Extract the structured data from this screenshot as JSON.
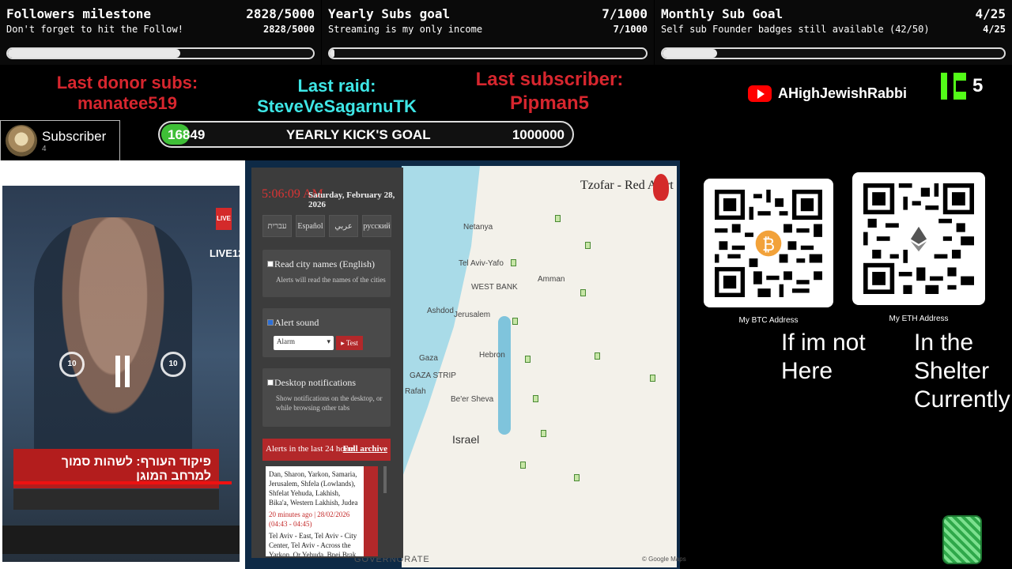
{
  "goals": [
    {
      "title": "Followers milestone",
      "count": "2828/5000",
      "subtitle": "Don't forget to hit the Follow!",
      "count2": "2828/5000",
      "progress": 0.5656
    },
    {
      "title": "Yearly Subs goal",
      "count": "7/1000",
      "subtitle": "Streaming is my only income",
      "count2": "7/1000",
      "progress": 0.007
    },
    {
      "title": "Monthly Sub Goal",
      "count": "4/25",
      "subtitle": "Self sub Founder badges still available (42/50)",
      "count2": "4/25",
      "progress": 0.16
    }
  ],
  "events": {
    "donor_label": "Last donor subs:",
    "donor_name": "manatee519",
    "raid_label": "Last raid:",
    "raid_name": "SteveVeSagarnuTK",
    "sub_label": "Last subscriber:",
    "sub_name": "Pipman5"
  },
  "youtube": {
    "channel": "AHighJewishRabbi"
  },
  "kick": {
    "count": "5"
  },
  "subscriber_card": {
    "title": "Subscriber",
    "count": "4"
  },
  "kick_goal": {
    "current": "16849",
    "label": "YEARLY KICK'S GOAL",
    "target": "1000000",
    "progress": 0.0168
  },
  "video": {
    "live_badge": "LIVE",
    "channel_logo": "LIVE12",
    "headline": "פיקוד העורף: לשהות סמוך למרחב המוגן",
    "skip_back": "10",
    "skip_forward": "10"
  },
  "tzofar": {
    "time": "5:06:09 AM",
    "date": "Saturday, February 28, 2026",
    "languages": [
      "עברית",
      "Español",
      "عربي",
      "русский"
    ],
    "read_city": {
      "title": "Read city names (English)",
      "desc": "Alerts will read the names of the cities",
      "checked": false
    },
    "alert_sound": {
      "title": "Alert sound",
      "select": "Alarm",
      "test": "Test",
      "checked": true
    },
    "desktop_notif": {
      "title": "Desktop notifications",
      "desc": "Show notifications on the desktop, or while browsing other tabs",
      "checked": false
    },
    "alerts_header": "Alerts in the last 24 hours",
    "full_archive": "Full archive",
    "alert1": "Dan, Sharon, Yarkon, Samaria, Jerusalem, Shfela (Lowlands), Shfelat Yehuda, Lakhish, Bika'a, Western Lakhish, Judea",
    "alert1_meta": "20 minutes ago | 28/02/2026 (04:43 - 04:45)",
    "alert2": "Tel Aviv - East, Tel Aviv - City Center, Tel Aviv - Across the Yarkon, Or Yehuda, Bnei Brak, Givat HaShlosha, Givat Hen, Givat Shmuel"
  },
  "map": {
    "brand": "Tzofar - Red Alert",
    "labels": {
      "netanya": "Netanya",
      "telaviv": "Tel Aviv-Yafo",
      "westbank": "WEST BANK",
      "amman": "Amman",
      "jerusalem": "Jerusalem",
      "ashdod": "Ashdod",
      "gaza": "Gaza",
      "gazastrip": "GAZA STRIP",
      "rafah": "Rafah",
      "hebron": "Hebron",
      "beersheva": "Be'er Sheva",
      "israel": "Israel",
      "governorate": "GOVERNORATE",
      "google": "© Google Maps"
    }
  },
  "donations": {
    "btc_label": "My BTC Address",
    "eth_label": "My ETH Address",
    "shelter_left": "If im not Here",
    "shelter_right": "In the Shelter Currently"
  },
  "colors": {
    "donor": "#d7262e",
    "raid": "#3ee6e6",
    "kick": "#53fc18",
    "youtube": "#ff0000",
    "alert_red": "#b3282a"
  }
}
